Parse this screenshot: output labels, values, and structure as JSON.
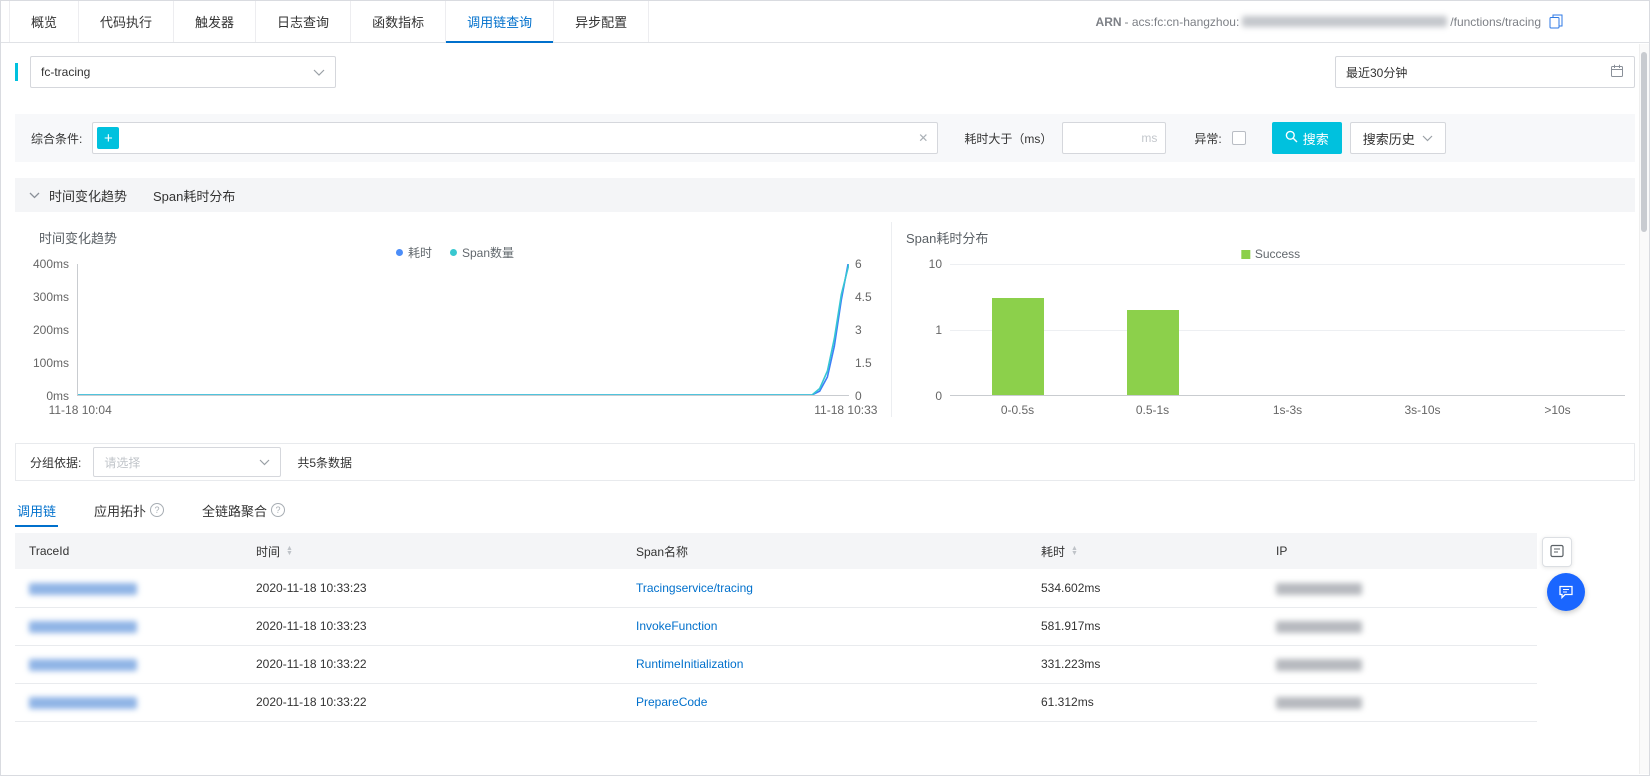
{
  "top_tabs": {
    "items": [
      {
        "name": "overview",
        "label": "概览"
      },
      {
        "name": "code-execution",
        "label": "代码执行"
      },
      {
        "name": "trigger",
        "label": "触发器"
      },
      {
        "name": "log-query",
        "label": "日志查询"
      },
      {
        "name": "function-metrics",
        "label": "函数指标"
      },
      {
        "name": "tracing-query",
        "label": "调用链查询"
      },
      {
        "name": "async-config",
        "label": "异步配置"
      }
    ],
    "active": "tracing-query"
  },
  "arn": {
    "label": "ARN",
    "mid": "- acs:fc:cn-hangzhou:",
    "suffix": "/functions/tracing"
  },
  "toolbar": {
    "service_value": "fc-tracing",
    "time_range_value": "最近30分钟"
  },
  "filter": {
    "condition_label": "综合条件:",
    "duration_label": "耗时大于（ms）",
    "duration_placeholder": "ms",
    "exception_label": "异常:",
    "search_label": "搜索",
    "history_label": "搜索历史"
  },
  "section_header": {
    "trend_title": "时间变化趋势",
    "dist_title": "Span耗时分布"
  },
  "chart_data": [
    {
      "type": "line",
      "title": "时间变化趋势",
      "legend": [
        {
          "key": "duration",
          "name": "耗时",
          "color": "#4b8df8"
        },
        {
          "key": "span-count",
          "name": "Span数量",
          "color": "#39c8d0"
        }
      ],
      "y_left_ticks": [
        "400ms",
        "300ms",
        "200ms",
        "100ms",
        "0ms"
      ],
      "y_right_ticks": [
        "6",
        "4.5",
        "3",
        "1.5",
        "0"
      ],
      "x_ticks": [
        "11-18 10:04",
        "11-18 10:33"
      ],
      "y_left_max": 400,
      "y_right_max": 6,
      "series": [
        {
          "key": "duration",
          "name": "耗时",
          "color": "#3e7ef7",
          "axis": "left",
          "points": [
            [
              0,
              0
            ],
            [
              0.9,
              0
            ],
            [
              0.952,
              0
            ],
            [
              0.962,
              12
            ],
            [
              0.972,
              55
            ],
            [
              0.981,
              150
            ],
            [
              0.99,
              290
            ],
            [
              1,
              415
            ]
          ]
        },
        {
          "key": "span-count",
          "name": "Span数量",
          "color": "#36c6d3",
          "axis": "right",
          "points": [
            [
              0,
              0
            ],
            [
              0.9,
              0
            ],
            [
              0.952,
              0
            ],
            [
              0.962,
              0.3
            ],
            [
              0.972,
              1.1
            ],
            [
              0.981,
              2.6
            ],
            [
              0.99,
              4.6
            ],
            [
              1,
              6
            ]
          ]
        }
      ]
    },
    {
      "type": "bar",
      "title": "Span耗时分布",
      "legend": [
        {
          "key": "success",
          "name": "Success",
          "color": "#8cd04b"
        }
      ],
      "categories": [
        "0-0.5s",
        "0.5-1s",
        "1s-3s",
        "3s-10s",
        ">10s"
      ],
      "values": [
        3,
        2,
        0,
        0,
        0
      ],
      "y_ticks": [
        "10",
        "1",
        "0"
      ],
      "scale": "log"
    }
  ],
  "group_row": {
    "label": "分组依据:",
    "placeholder": "请选择",
    "total": "共5条数据"
  },
  "lower_tabs": {
    "items": [
      {
        "name": "trace-list",
        "label": "调用链",
        "help": false
      },
      {
        "name": "app-topology",
        "label": "应用拓扑",
        "help": true
      },
      {
        "name": "full-trace-aggregation",
        "label": "全链路聚合",
        "help": true
      }
    ],
    "active": "trace-list"
  },
  "table": {
    "columns": [
      {
        "name": "trace-id",
        "label": "TraceId",
        "sortable": false
      },
      {
        "name": "time",
        "label": "时间",
        "sortable": true
      },
      {
        "name": "span-name",
        "label": "Span名称",
        "sortable": false
      },
      {
        "name": "duration",
        "label": "耗时",
        "sortable": true
      },
      {
        "name": "ip",
        "label": "IP",
        "sortable": false
      }
    ],
    "rows": [
      {
        "time": "2020-11-18 10:33:23",
        "span": "Tracingservice/tracing",
        "duration": "534.602ms"
      },
      {
        "time": "2020-11-18 10:33:23",
        "span": "InvokeFunction",
        "duration": "581.917ms"
      },
      {
        "time": "2020-11-18 10:33:22",
        "span": "RuntimeInitialization",
        "duration": "331.223ms"
      },
      {
        "time": "2020-11-18 10:33:22",
        "span": "PrepareCode",
        "duration": "61.312ms"
      }
    ]
  },
  "colors": {
    "accent_teal": "#00c1de",
    "link_blue": "#0070cc",
    "bar_green": "#8cd04b"
  }
}
